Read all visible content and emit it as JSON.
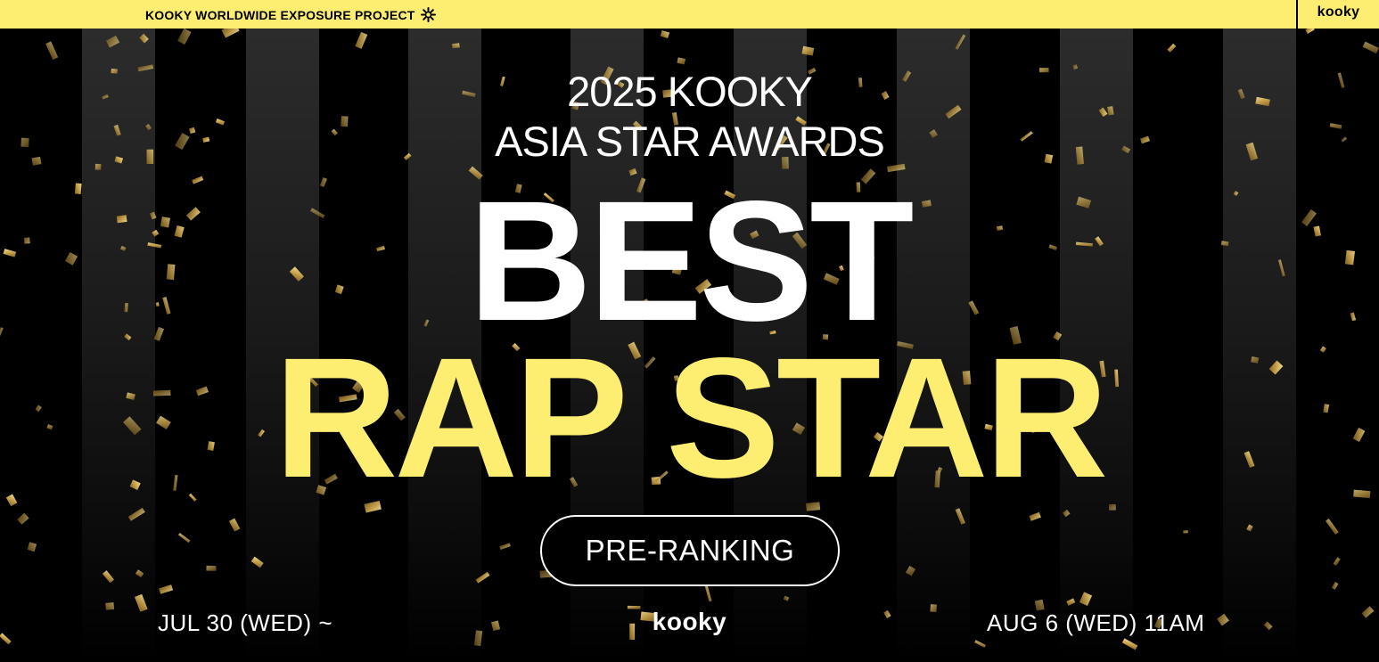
{
  "topbar": {
    "project_label": "KOOKY WORLDWIDE EXPOSURE PROJECT",
    "project_icon": "sparkle-icon",
    "logo": "kooky"
  },
  "hero": {
    "subtitle_line1": "2025 KOOKY",
    "subtitle_line2": "ASIA STAR AWARDS",
    "headline_line1": "BEST",
    "headline_line2": "RAP STAR",
    "cta_label": "PRE-RANKING"
  },
  "footer": {
    "start_date": "JUL 30 (WED) ~",
    "logo": "kooky",
    "end_date": "AUG 6 (WED) 11AM"
  },
  "colors": {
    "accent_yellow": "#fdee72",
    "background": "#000000",
    "text_white": "#ffffff",
    "confetti_gold": "#d4b35a"
  }
}
